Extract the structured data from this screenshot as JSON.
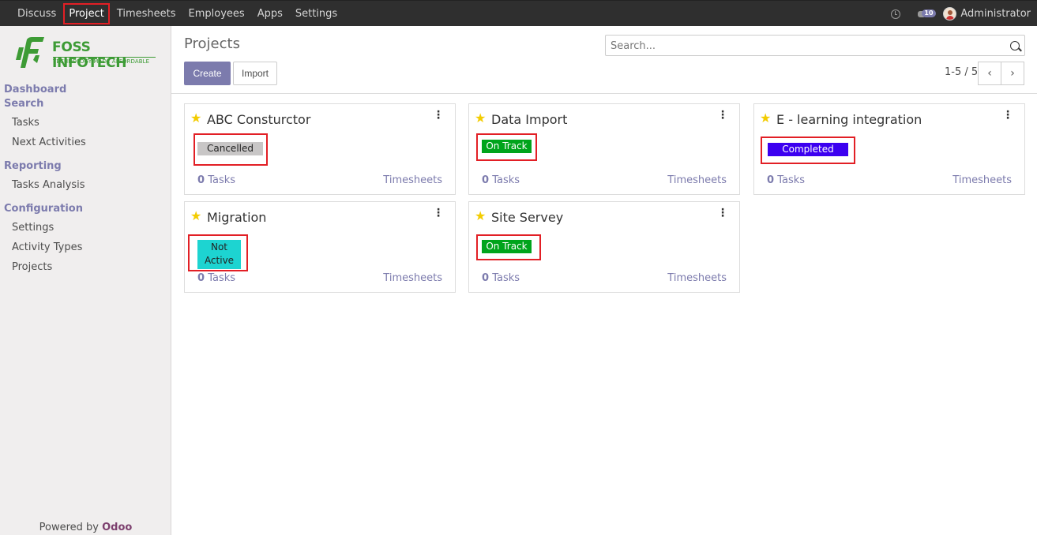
{
  "topbar": {
    "menu": [
      "Discuss",
      "Project",
      "Timesheets",
      "Employees",
      "Apps",
      "Settings"
    ],
    "active": "Project",
    "messages_count": "10",
    "user": "Administrator"
  },
  "logo": {
    "brand": "FOSS INFOTECH",
    "tagline": "TECHNOLOGY MADE AFFORDABLE"
  },
  "sidebar": {
    "dashboard": "Dashboard",
    "search": "Search",
    "tasks": "Tasks",
    "next_activities": "Next Activities",
    "reporting": "Reporting",
    "tasks_analysis": "Tasks Analysis",
    "configuration": "Configuration",
    "settings": "Settings",
    "activity_types": "Activity Types",
    "projects": "Projects",
    "powered_prefix": "Powered by ",
    "powered_brand": "Odoo"
  },
  "control": {
    "breadcrumb": "Projects",
    "create": "Create",
    "import": "Import",
    "search_placeholder": "Search...",
    "pager": "1-5 / 5"
  },
  "cards": [
    {
      "title": "ABC Consturctor",
      "status": "Cancelled",
      "status_color": "#c8c6c6",
      "status_text_color": "#222",
      "tasks_count": "0",
      "tasks_label": "Tasks",
      "timesheets": "Timesheets"
    },
    {
      "title": "Data Import",
      "status": "On Track",
      "status_color": "#00a41b",
      "status_text_color": "#ffffff",
      "tasks_count": "0",
      "tasks_label": "Tasks",
      "timesheets": "Timesheets"
    },
    {
      "title": "E - learning integration",
      "status": "Completed",
      "status_color": "#3c00f0",
      "status_text_color": "#ffffff",
      "tasks_count": "0",
      "tasks_label": "Tasks",
      "timesheets": "Timesheets"
    },
    {
      "title": "Migration",
      "status_line1": "Not",
      "status_line2": "Active",
      "status_color": "#1dd4d1",
      "status_text_color": "#222",
      "tasks_count": "0",
      "tasks_label": "Tasks",
      "timesheets": "Timesheets"
    },
    {
      "title": "Site Servey",
      "status": "On Track",
      "status_color": "#00a41b",
      "status_text_color": "#ffffff",
      "tasks_count": "0",
      "tasks_label": "Tasks",
      "timesheets": "Timesheets"
    }
  ]
}
